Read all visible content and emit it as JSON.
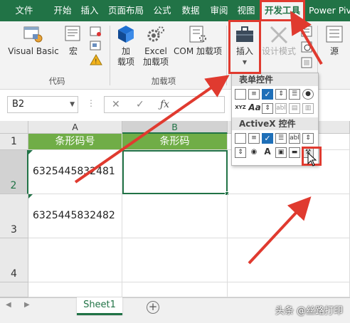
{
  "ribbon": {
    "tabs": [
      "文件",
      "开始",
      "插入",
      "页面布局",
      "公式",
      "数据",
      "审阅",
      "视图",
      "开发工具",
      "Power Pivot"
    ],
    "active_tab": "开发工具",
    "buttons": {
      "visual_basic": "Visual Basic",
      "macro": "宏",
      "addins_1": "加",
      "addins_2": "载项",
      "excel_addins_1": "Excel",
      "excel_addins_2": "加载项",
      "com_addins": "COM 加载项",
      "insert": "插入",
      "design_mode": "设计模式",
      "source": "源"
    },
    "groups": {
      "code": "代码",
      "addins": "加载项"
    }
  },
  "formula_bar": {
    "name_box": "B2",
    "formula": ""
  },
  "insert_panel": {
    "form_controls_title": "表单控件",
    "activex_title": "ActiveX 控件",
    "xyz_label": "XYZ",
    "aa_label": "Aa",
    "abl_label": "abl",
    "a_label": "A"
  },
  "sheet": {
    "columns": [
      "A",
      "B"
    ],
    "rows": [
      "1",
      "2",
      "3",
      "4"
    ],
    "header_row": [
      "条形码号",
      "条形码"
    ],
    "data": [
      [
        "6325445832481",
        ""
      ],
      [
        "6325445832482",
        ""
      ]
    ],
    "selected_cell": "B2"
  },
  "sheet_tabs": {
    "active": "Sheet1",
    "add_symbol": "+"
  },
  "watermark": "头条 @丝路打印",
  "colors": {
    "excel_green": "#217346",
    "header_fill": "#70ad47",
    "highlight_red": "#e03a2f"
  }
}
